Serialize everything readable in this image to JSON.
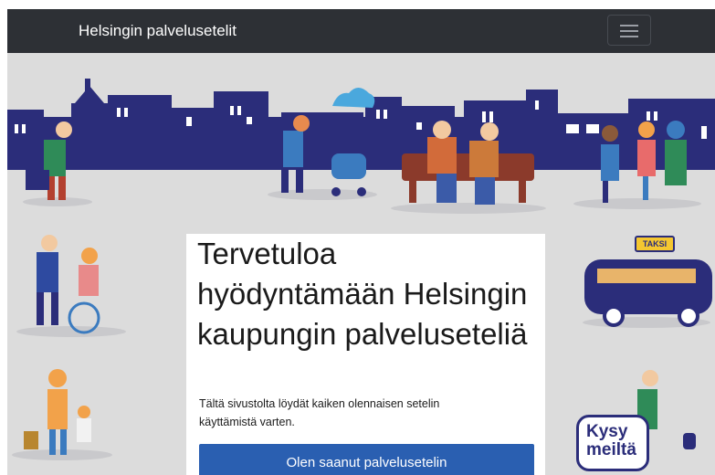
{
  "navbar": {
    "brand": "Helsingin palvelusetelit",
    "menu_icon": "hamburger-menu-icon"
  },
  "hero": {
    "title": "Tervetuloa hyödyntämään Helsingin kaupungin palveluseteliä",
    "description": "Tältä sivustolta löydät kaiken olennaisen setelin käyttämistä varten.",
    "cta_label": "Olen saanut palvelusetelin"
  },
  "illustration": {
    "taxi_sign": "TAKSI",
    "help_bubble_line1": "Kysy",
    "help_bubble_line2": "meiltä"
  },
  "colors": {
    "navbar_bg": "#2d3035",
    "hero_bg": "#dcdcdc",
    "skyline": "#2b2d7a",
    "cta_bg": "#2a5fb1",
    "taxi_yellow": "#f5c730"
  }
}
